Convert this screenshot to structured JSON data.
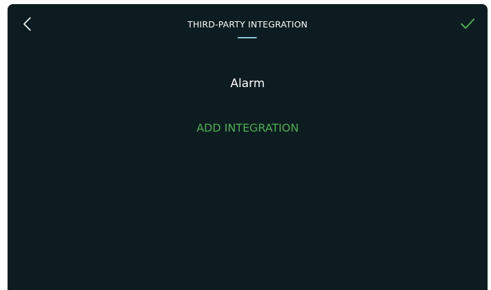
{
  "header": {
    "title": "THIRD-PARTY INTEGRATION",
    "back_icon": "chevron-left-icon",
    "confirm_icon": "checkmark-icon"
  },
  "main": {
    "section_label": "Alarm",
    "add_integration_label": "ADD INTEGRATION"
  },
  "colors": {
    "background": "#0c1c21",
    "accent_green": "#4caf50",
    "underline": "#8ec6d4"
  }
}
